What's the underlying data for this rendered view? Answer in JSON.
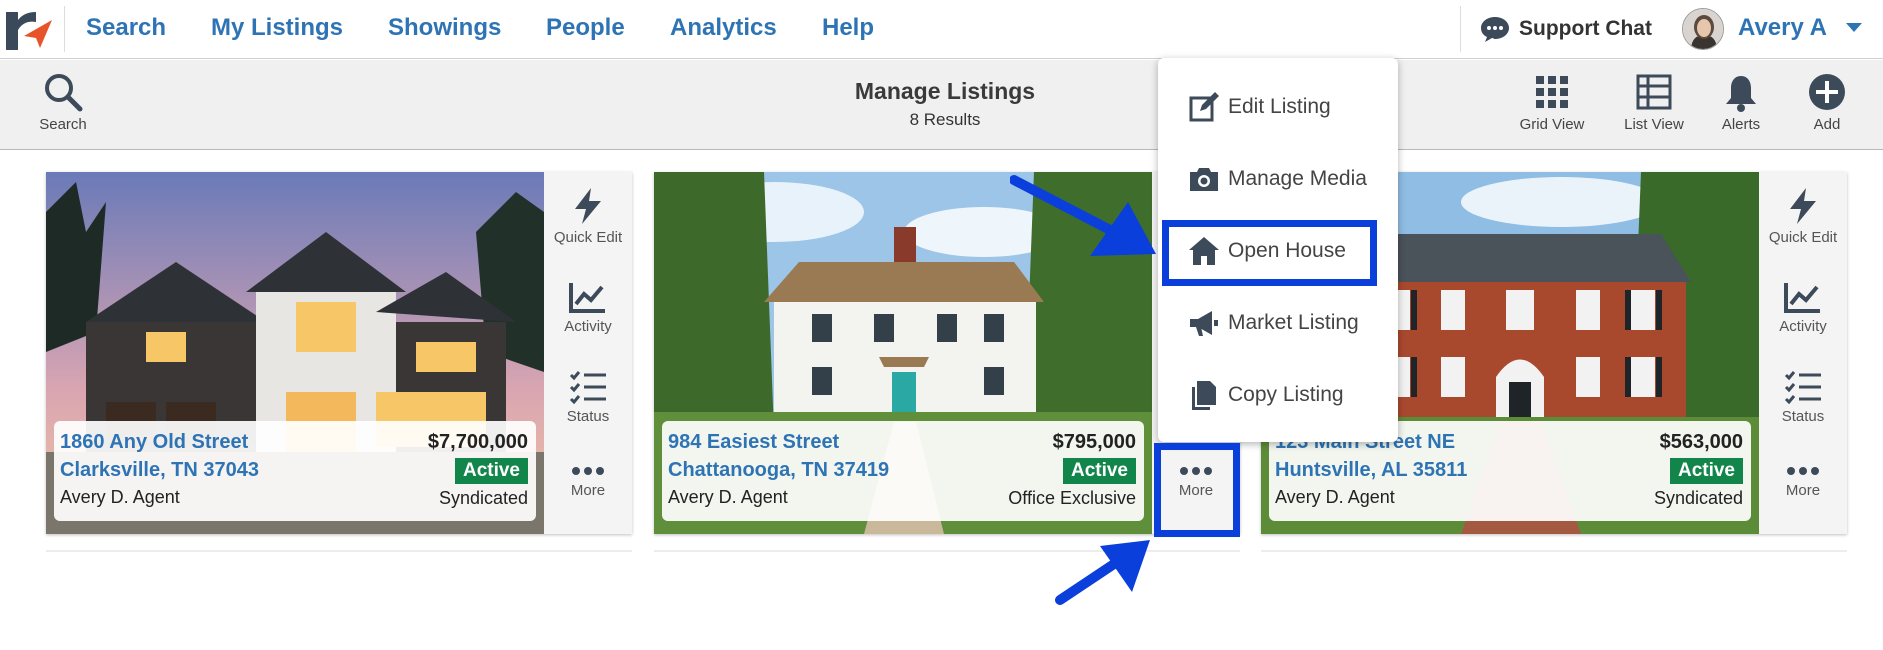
{
  "nav": {
    "items": [
      "Search",
      "My Listings",
      "Showings",
      "People",
      "Analytics",
      "Help"
    ],
    "support_chat": "Support Chat",
    "user_name": "Avery A"
  },
  "toolbar": {
    "search_label": "Search",
    "title": "Manage Listings",
    "subtitle": "8 Results",
    "grid_view_label": "Grid View",
    "list_view_label": "List View",
    "alerts_label": "Alerts",
    "add_label": "Add"
  },
  "side_actions": {
    "quick_edit": "Quick Edit",
    "activity": "Activity",
    "status": "Status",
    "more": "More"
  },
  "listings": [
    {
      "street": "1860 Any Old Street",
      "city": "Clarksville, TN 37043",
      "agent": "Avery D. Agent",
      "price": "$7,700,000",
      "status": "Active",
      "distribution": "Syndicated"
    },
    {
      "street": "984 Easiest Street",
      "city": "Chattanooga, TN 37419",
      "agent": "Avery D. Agent",
      "price": "$795,000",
      "status": "Active",
      "distribution": "Office Exclusive"
    },
    {
      "street": "123 Main Street NE",
      "city": "Huntsville, AL 35811",
      "agent": "Avery D. Agent",
      "price": "$563,000",
      "status": "Active",
      "distribution": "Syndicated"
    }
  ],
  "more_menu": {
    "items": [
      "Edit Listing",
      "Manage Media",
      "Open House",
      "Market Listing",
      "Copy Listing"
    ],
    "highlighted": "Open House"
  },
  "colors": {
    "link_blue": "#2e74b5",
    "active_green": "#11854a",
    "highlight_blue": "#0a3fdc",
    "logo_orange": "#e8542a"
  }
}
